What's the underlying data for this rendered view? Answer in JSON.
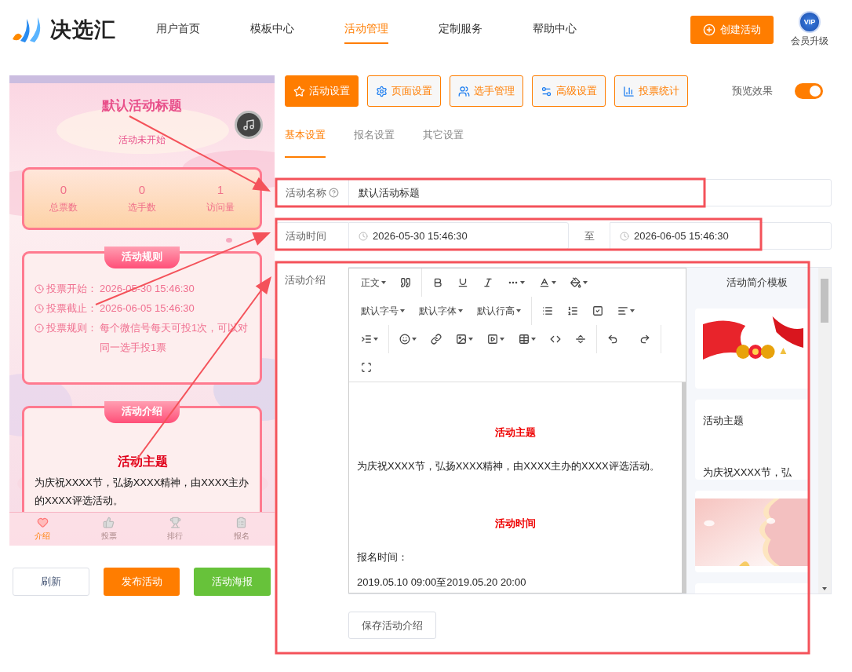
{
  "header": {
    "logo": "决选汇",
    "nav": [
      {
        "label": "用户首页",
        "selected": false
      },
      {
        "label": "模板中心",
        "selected": false
      },
      {
        "label": "活动管理",
        "selected": true
      },
      {
        "label": "定制服务",
        "selected": false
      },
      {
        "label": "帮助中心",
        "selected": false
      }
    ],
    "create_button": "创建活动",
    "vip_badge": "VIP",
    "vip_label": "会员升级"
  },
  "preview": {
    "title": "默认活动标题",
    "status": "活动未开始",
    "stats": [
      {
        "value": "0",
        "label": "总票数"
      },
      {
        "value": "0",
        "label": "选手数"
      },
      {
        "value": "1",
        "label": "访问量"
      }
    ],
    "rules": {
      "heading": "活动规则",
      "items": [
        {
          "kind": "clock",
          "label": "投票开始：",
          "value": "2026-05-30 15:46:30"
        },
        {
          "kind": "clock",
          "label": "投票截止：",
          "value": "2026-06-05 15:46:30"
        },
        {
          "kind": "alert",
          "label": "投票规则：",
          "value": "每个微信号每天可投1次，可以对同一选手投1票"
        }
      ]
    },
    "intro": {
      "heading": "活动介绍",
      "title": "活动主题",
      "body": "为庆祝XXXX节，弘扬XXXX精神，由XXXX主办的XXXX评选活动。"
    },
    "nav": [
      {
        "label": "介绍",
        "selected": true
      },
      {
        "label": "投票",
        "selected": false
      },
      {
        "label": "排行",
        "selected": false
      },
      {
        "label": "报名",
        "selected": false
      }
    ]
  },
  "actions": [
    {
      "label": "刷新",
      "kind": "default"
    },
    {
      "label": "发布活动",
      "kind": "primary"
    },
    {
      "label": "活动海报",
      "kind": "success"
    }
  ],
  "tabs": [
    {
      "label": "活动设置",
      "selected": true
    },
    {
      "label": "页面设置",
      "selected": false
    },
    {
      "label": "选手管理",
      "selected": false
    },
    {
      "label": "高级设置",
      "selected": false
    },
    {
      "label": "投票统计",
      "selected": false
    }
  ],
  "preview_toggle": {
    "label": "预览效果",
    "on": true
  },
  "subtabs": [
    {
      "label": "基本设置",
      "selected": true
    },
    {
      "label": "报名设置",
      "selected": false
    },
    {
      "label": "其它设置",
      "selected": false
    }
  ],
  "form": {
    "name": {
      "label": "活动名称",
      "value": "默认活动标题"
    },
    "time": {
      "label": "活动时间",
      "start": "2026-05-30 15:46:30",
      "separator": "至",
      "end": "2026-06-05 15:46:30"
    },
    "intro": {
      "label": "活动介绍",
      "toolbar_labels": [
        "正文",
        "默认字号",
        "默认字体",
        "默认行高"
      ],
      "content": [
        {
          "kind": "heading",
          "text": "活动主题"
        },
        {
          "kind": "paragraph",
          "text": "为庆祝XXXX节，弘扬XXXX精神，由XXXX主办的XXXX评选活动。"
        },
        {
          "kind": "heading",
          "text": "活动时间"
        },
        {
          "kind": "paragraph",
          "text": "报名时间："
        },
        {
          "kind": "paragraph",
          "text": "2019.05.10 09:00至2019.05.20 20:00"
        }
      ],
      "templates": {
        "title": "活动简介模板",
        "items": [
          {
            "kind": "picture"
          },
          {
            "kind": "text",
            "title": "活动主题",
            "body": "为庆祝XXXX节，弘"
          },
          {
            "kind": "picture"
          },
          {
            "kind": "blank"
          }
        ]
      },
      "save_button": "保存活动介绍"
    }
  }
}
